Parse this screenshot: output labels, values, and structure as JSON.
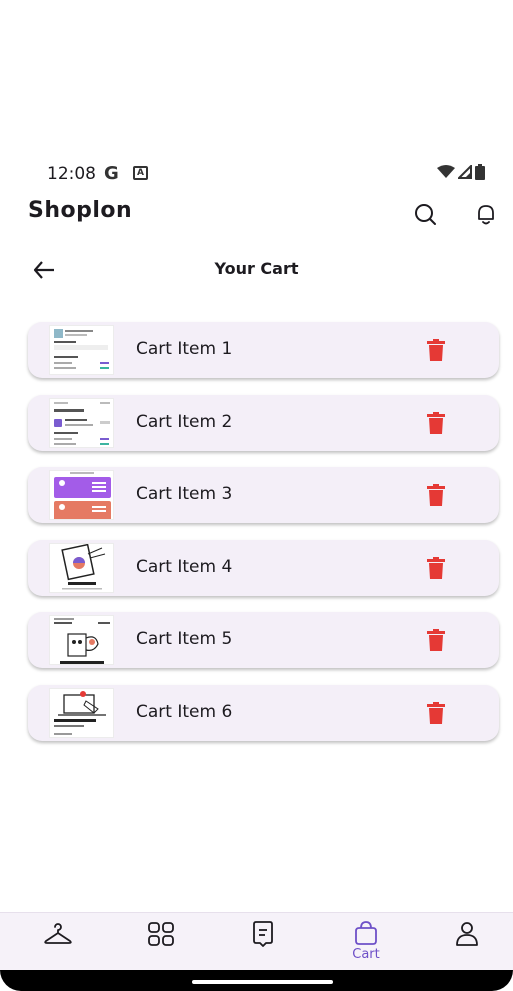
{
  "status_bar": {
    "time": "12:08",
    "g_icon": "G",
    "notification_icon": "A"
  },
  "app": {
    "title": "Shoplon"
  },
  "page": {
    "title": "Your Cart"
  },
  "cart": {
    "items": [
      {
        "name": "Cart Item 1"
      },
      {
        "name": "Cart Item 2"
      },
      {
        "name": "Cart Item 3"
      },
      {
        "name": "Cart Item 4"
      },
      {
        "name": "Cart Item 5"
      },
      {
        "name": "Cart Item 6"
      }
    ]
  },
  "nav": {
    "items": [
      {
        "icon": "hanger-icon",
        "label": ""
      },
      {
        "icon": "grid-icon",
        "label": ""
      },
      {
        "icon": "bookmark-icon",
        "label": ""
      },
      {
        "icon": "bag-icon",
        "label": "Cart",
        "active": true
      },
      {
        "icon": "profile-icon",
        "label": ""
      }
    ]
  },
  "colors": {
    "accent": "#6e50c8",
    "delete": "#e53935",
    "card_bg": "#f4eff8",
    "nav_bg": "#f6f2f9"
  }
}
